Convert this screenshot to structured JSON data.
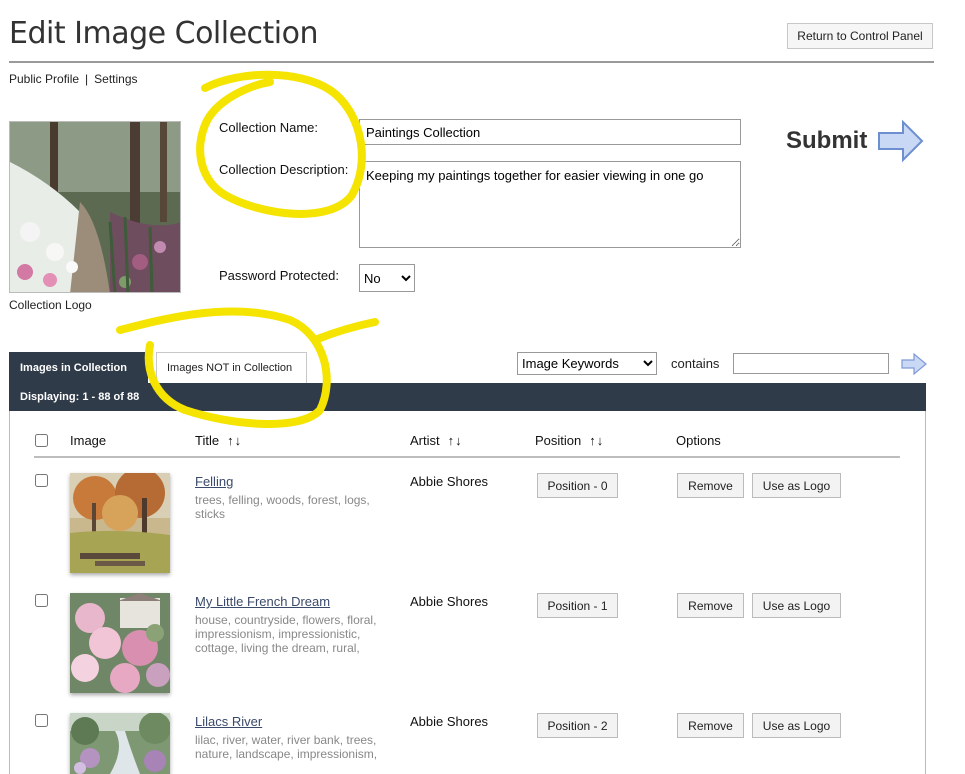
{
  "header": {
    "title": "Edit Image Collection",
    "return_label": "Return to Control Panel"
  },
  "subnav": {
    "public_profile": "Public Profile",
    "separator": "|",
    "settings": "Settings"
  },
  "logo": {
    "caption": "Collection Logo"
  },
  "form": {
    "name_label": "Collection Name:",
    "name_value": "Paintings Collection",
    "description_label": "Collection Description:",
    "description_value": "Keeping my paintings together for easier viewing in one go",
    "password_label": "Password Protected:",
    "password_value": "No",
    "submit_label": "Submit"
  },
  "tabs": {
    "in_collection": "Images in Collection",
    "not_in_collection": "Images NOT in Collection"
  },
  "filter": {
    "field_value": "Image Keywords",
    "contains_label": "contains",
    "query_value": ""
  },
  "listing": {
    "displaying": "Displaying: 1 - 88 of 88",
    "columns": {
      "image": "Image",
      "title": "Title",
      "artist": "Artist",
      "position": "Position",
      "options": "Options",
      "sort_arrows": "↑↓"
    },
    "rows": [
      {
        "title": "Felling ",
        "keywords": "trees, felling, woods, forest, logs, sticks",
        "artist": "Abbie Shores",
        "position": "Position - 0",
        "remove": "Remove",
        "use_logo": "Use as Logo"
      },
      {
        "title": "My Little French Dream",
        "keywords": "house, countryside, flowers, floral, impressionism, impressionistic, cottage, living the dream, rural,",
        "artist": "Abbie Shores",
        "position": "Position - 1",
        "remove": "Remove",
        "use_logo": "Use as Logo"
      },
      {
        "title": "Lilacs River",
        "keywords": "lilac, river, water, river bank, trees, nature, landscape, impressionism,",
        "artist": "Abbie Shores",
        "position": "Position - 2",
        "remove": "Remove",
        "use_logo": "Use as Logo"
      }
    ]
  },
  "colors": {
    "dark_bar": "#2f3b49",
    "highlight": "#f5e400",
    "link": "#3a4a6a",
    "arrow_fill": "#c9d8f5"
  },
  "icons": {
    "submit": "arrow-right-icon",
    "filter_go": "arrow-right-icon"
  }
}
